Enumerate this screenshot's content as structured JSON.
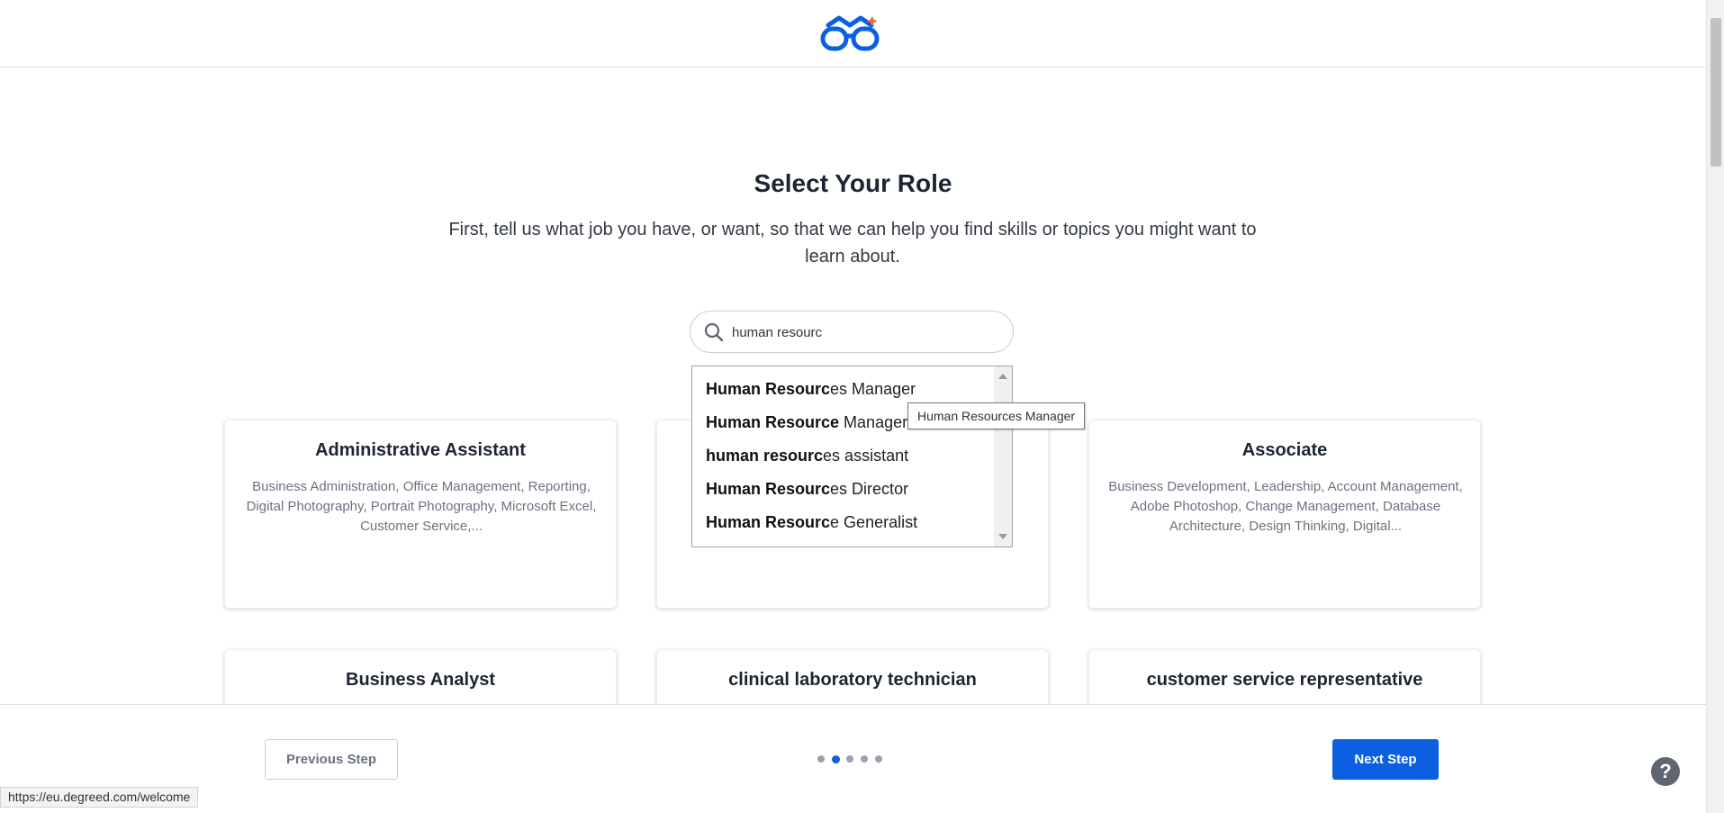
{
  "brand": {
    "accent": "#0b5fe0",
    "logo_icon": "degreed-glasses-logo-icon"
  },
  "header": {
    "title": "Select Your Role",
    "subtitle": "First, tell us what job you have, or want, so that we can help you find skills or topics you might want to learn about."
  },
  "search": {
    "value": "human resourc",
    "icon": "search-icon"
  },
  "autocomplete": {
    "items": [
      {
        "match": "Human Resourc",
        "rest": "es Manager"
      },
      {
        "match": "Human Resource",
        "rest": " Manager"
      },
      {
        "match": "human resourc",
        "rest": "es assistant"
      },
      {
        "match": "Human Resourc",
        "rest": "es Director"
      },
      {
        "match": "Human Resourc",
        "rest": "e Generalist"
      }
    ],
    "tooltip": "Human Resources Manager"
  },
  "cards": [
    {
      "title": "Administrative Assistant",
      "skills": "Business Administration, Office Management, Reporting, Digital Photography, Portrait Photography, Microsoft Excel, Customer Service,..."
    },
    {
      "title": "",
      "skills": ""
    },
    {
      "title": "Associate",
      "skills": "Business Development, Leadership, Account Management, Adobe Photoshop, Change Management, Database Architecture, Design Thinking, Digital..."
    },
    {
      "title": "Business Analyst",
      "skills": ""
    },
    {
      "title": "clinical laboratory technician",
      "skills": ""
    },
    {
      "title": "customer service representative",
      "skills": ""
    }
  ],
  "footer": {
    "previous_label": "Previous Step",
    "next_label": "Next Step",
    "steps_total": 5,
    "steps_current": 2,
    "help_label": "?"
  },
  "status_bar": {
    "url": "https://eu.degreed.com/welcome"
  }
}
